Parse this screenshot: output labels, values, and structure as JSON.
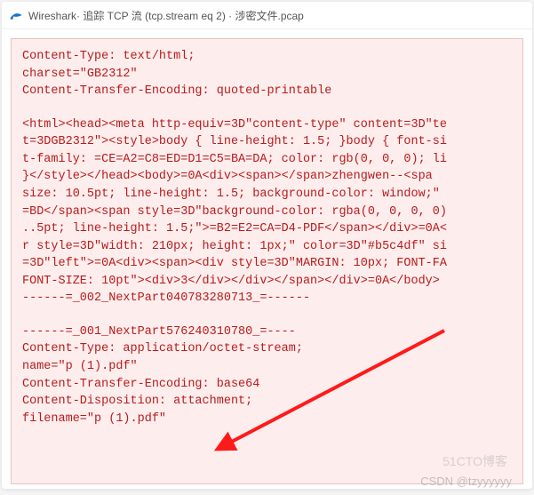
{
  "titlebar": {
    "app": "Wireshark",
    "middle": "· 追踪 TCP 流 (tcp.stream eq 2) · ",
    "file": "涉密文件.pcap"
  },
  "lines": [
    "Content-Type: text/html;",
    "        charset=\"GB2312\"",
    "Content-Transfer-Encoding: quoted-printable",
    "",
    "<html><head><meta http-equiv=3D\"content-type\" content=3D\"te",
    "t=3DGB2312\"><style>body { line-height: 1.5; }body { font-si",
    "t-family: =CE=A2=C8=ED=D1=C5=BA=DA; color: rgb(0, 0, 0); li",
    " }</style></head><body>=0A<div><span></span>zhengwen--<spa",
    "size: 10.5pt; line-height: 1.5; background-color: window;\"",
    "=BD</span><span style=3D\"background-color: rgba(0, 0, 0, 0)",
    "..5pt; line-height: 1.5;\">=B2=E2=CA=D4-PDF</span></div>=0A<",
    "r style=3D\"width: 210px; height: 1px;\" color=3D\"#b5c4df\" si",
    "=3D\"left\">=0A<div><span><div style=3D\"MARGIN: 10px; FONT-FA",
    "FONT-SIZE: 10pt\"><div>3</div></div></span></div>=0A</body>",
    "------=_002_NextPart040783280713_=------",
    "",
    "------=_001_NextPart576240310780_=----",
    "Content-Type: application/octet-stream;",
    "        name=\"p (1).pdf\"",
    "Content-Transfer-Encoding: base64",
    "Content-Disposition: attachment;",
    "        filename=\"p (1).pdf\""
  ],
  "watermarks": {
    "w1": "CSDN @tzyyyyyy",
    "w2": "51CTO博客"
  }
}
